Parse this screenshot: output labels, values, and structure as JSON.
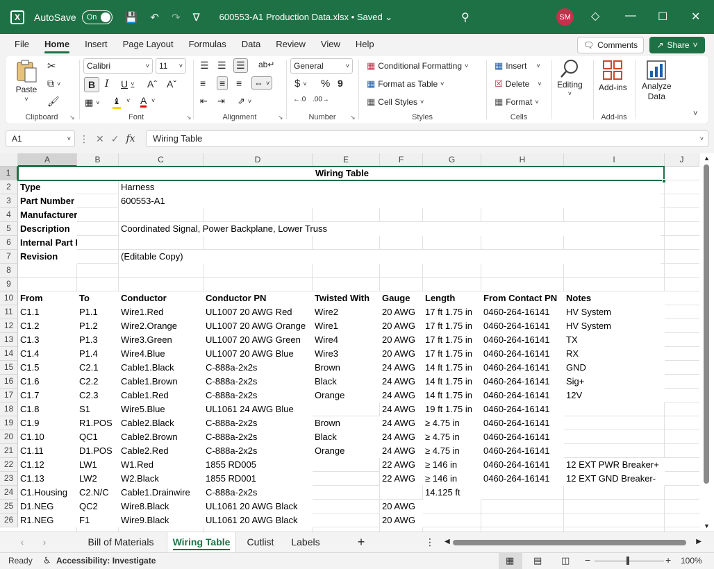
{
  "titlebar": {
    "autosave_label": "AutoSave",
    "autosave_state": "On",
    "title": "600553-A1 Production Data.xlsx • Saved ⌄",
    "avatar": "SM"
  },
  "menu": [
    "File",
    "Home",
    "Insert",
    "Page Layout",
    "Formulas",
    "Data",
    "Review",
    "View",
    "Help"
  ],
  "comments_label": "Comments",
  "share_label": "Share",
  "ribbon": {
    "clipboard": {
      "label": "Clipboard",
      "paste": "Paste"
    },
    "font": {
      "label": "Font",
      "name": "Calibri",
      "size": "11"
    },
    "alignment": {
      "label": "Alignment"
    },
    "number": {
      "label": "Number",
      "format": "General"
    },
    "styles": {
      "label": "Styles",
      "conditional": "Conditional Formatting",
      "format_table": "Format as Table",
      "cell_styles": "Cell Styles"
    },
    "cells": {
      "label": "Cells",
      "insert": "Insert",
      "delete": "Delete",
      "format": "Format"
    },
    "editing": {
      "label": "Editing"
    },
    "addins": {
      "label": "Add-ins",
      "button": "Add-ins"
    },
    "analyze": {
      "line1": "Analyze",
      "line2": "Data"
    }
  },
  "formula": {
    "namebox": "A1",
    "value": "Wiring Table"
  },
  "sheet": {
    "columns": [
      "A",
      "B",
      "C",
      "D",
      "E",
      "F",
      "G",
      "H",
      "I",
      "J"
    ],
    "title": "Wiring Table",
    "meta": [
      {
        "label": "Type",
        "value": "Harness"
      },
      {
        "label": "Part Number",
        "value": "600553-A1"
      },
      {
        "label": "Manufacturer",
        "value": ""
      },
      {
        "label": "Description",
        "value": "Coordinated Signal, Power Backplane, Lower Truss"
      },
      {
        "label": "Internal Part Number",
        "value": ""
      },
      {
        "label": "Revision",
        "value": "(Editable Copy)"
      }
    ],
    "headers": [
      "From",
      "To",
      "Conductor",
      "Conductor PN",
      "Twisted With",
      "Gauge",
      "Length",
      "From Contact PN",
      "Notes"
    ],
    "rows": [
      [
        "C1.1",
        "P1.1",
        "Wire1.Red",
        "UL1007 20 AWG Red",
        "Wire2",
        "20 AWG",
        "17 ft 1.75 in",
        "0460-264-16141",
        "HV System"
      ],
      [
        "C1.2",
        "P1.2",
        "Wire2.Orange",
        "UL1007 20 AWG Orange",
        "Wire1",
        "20 AWG",
        "17 ft 1.75 in",
        "0460-264-16141",
        "HV System"
      ],
      [
        "C1.3",
        "P1.3",
        "Wire3.Green",
        "UL1007 20 AWG Green",
        "Wire4",
        "20 AWG",
        "17 ft 1.75 in",
        "0460-264-16141",
        "TX"
      ],
      [
        "C1.4",
        "P1.4",
        "Wire4.Blue",
        "UL1007 20 AWG Blue",
        "Wire3",
        "20 AWG",
        "17 ft 1.75 in",
        "0460-264-16141",
        "RX"
      ],
      [
        "C1.5",
        "C2.1",
        "Cable1.Black",
        "C-888a-2x2s",
        "Brown",
        "24 AWG",
        "14 ft 1.75 in",
        "0460-264-16141",
        "GND"
      ],
      [
        "C1.6",
        "C2.2",
        "Cable1.Brown",
        "C-888a-2x2s",
        "Black",
        "24 AWG",
        "14 ft 1.75 in",
        "0460-264-16141",
        "Sig+"
      ],
      [
        "C1.7",
        "C2.3",
        "Cable1.Red",
        "C-888a-2x2s",
        "Orange",
        "24 AWG",
        "14 ft 1.75 in",
        "0460-264-16141",
        "12V"
      ],
      [
        "C1.8",
        "S1",
        "Wire5.Blue",
        "UL1061 24 AWG Blue",
        "",
        "24 AWG",
        "19 ft 1.75 in",
        "0460-264-16141",
        ""
      ],
      [
        "C1.9",
        "R1.POS",
        "Cable2.Black",
        "C-888a-2x2s",
        "Brown",
        "24 AWG",
        "≥ 4.75 in",
        "0460-264-16141",
        ""
      ],
      [
        "C1.10",
        "QC1",
        "Cable2.Brown",
        "C-888a-2x2s",
        "Black",
        "24 AWG",
        "≥ 4.75 in",
        "0460-264-16141",
        ""
      ],
      [
        "C1.11",
        "D1.POS",
        "Cable2.Red",
        "C-888a-2x2s",
        "Orange",
        "24 AWG",
        "≥ 4.75 in",
        "0460-264-16141",
        ""
      ],
      [
        "C1.12",
        "LW1",
        "W1.Red",
        "1855 RD005",
        "",
        "22 AWG",
        "≥ 146 in",
        "0460-264-16141",
        "12 EXT PWR Breaker+"
      ],
      [
        "C1.13",
        "LW2",
        "W2.Black",
        "1855 RD001",
        "",
        "22 AWG",
        "≥ 146 in",
        "0460-264-16141",
        "12 EXT GND Breaker-"
      ],
      [
        "C1.Housing",
        "C2.N/C",
        "Cable1.Drainwire",
        "C-888a-2x2s",
        "",
        "",
        "14.125 ft",
        "",
        ""
      ],
      [
        "D1.NEG",
        "QC2",
        "Wire8.Black",
        "UL1061 20 AWG Black",
        "",
        "20 AWG",
        "",
        "",
        ""
      ],
      [
        "R1.NEG",
        "F1",
        "Wire9.Black",
        "UL1061 20 AWG Black",
        "",
        "20 AWG",
        "",
        "",
        ""
      ]
    ]
  },
  "tabs": [
    "Bill of Materials",
    "Wiring Table",
    "Cutlist",
    "Labels"
  ],
  "active_tab": "Wiring Table",
  "status": {
    "ready": "Ready",
    "accessibility": "Accessibility: Investigate",
    "zoom": "100%"
  }
}
